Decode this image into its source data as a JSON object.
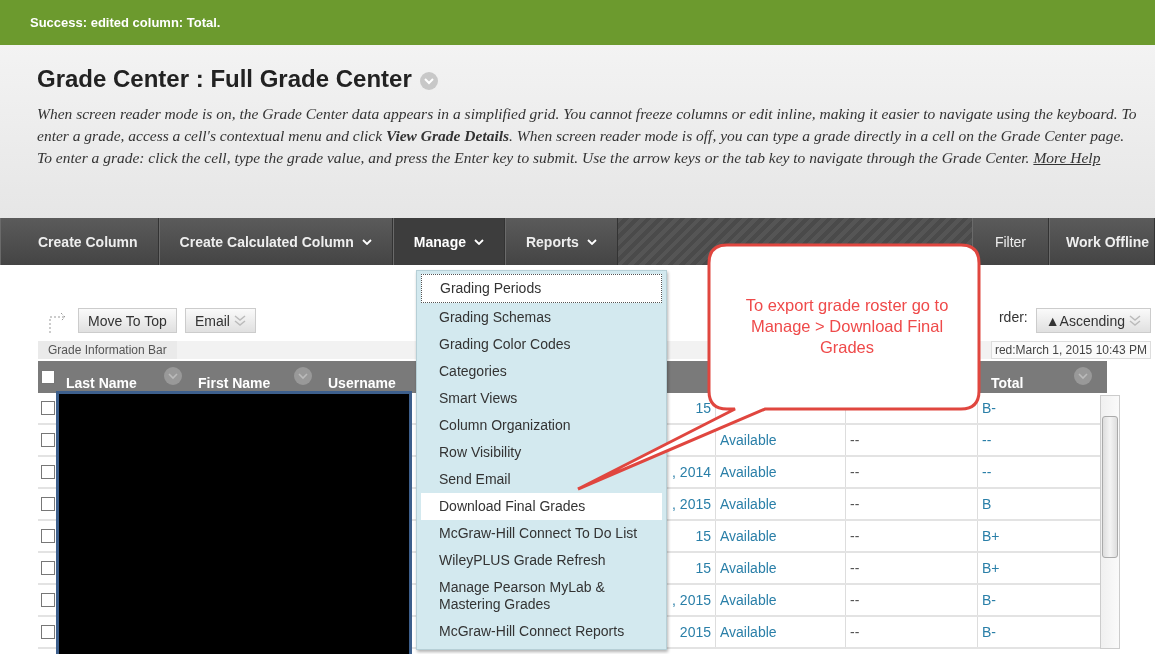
{
  "alert": {
    "text": "Success: edited column: Total."
  },
  "header": {
    "title": "Grade Center : Full Grade Center",
    "description": "When screen reader mode is on, the Grade Center data appears in a simplified grid. You cannot freeze columns or edit inline, making it easier to navigate using the keyboard. To enter a grade, access a cell's contextual menu and click **View Grade Details**. When screen reader mode is off, you can type a grade directly in a cell on the Grade Center page. To enter a grade: click the cell, type the grade value, and press the Enter key to submit. Use the arrow keys or the tab key to navigate through the Grade Center.",
    "help_link": "More Help"
  },
  "toolbar": [
    {
      "label": "Create Column",
      "has_menu": false,
      "selected": false
    },
    {
      "label": "Create Calculated Column",
      "has_menu": true,
      "selected": false
    },
    {
      "label": "Manage",
      "has_menu": true,
      "selected": true
    },
    {
      "label": "Reports",
      "has_menu": true,
      "selected": false
    }
  ],
  "toolbar_right": [
    {
      "label": "Filter",
      "bold": false
    },
    {
      "label": "Work Offline",
      "bold": true
    }
  ],
  "actions": [
    {
      "label": "Move To Top",
      "has_menu": false
    },
    {
      "label": "Email",
      "has_menu": true
    }
  ],
  "info_bar": {
    "label": "Grade Information Bar"
  },
  "sort": {
    "label": "rder:",
    "value": "▲Ascending"
  },
  "last_saved": "red:March 1, 2015 10:43 PM",
  "grid": {
    "select_all": false,
    "columns": [
      {
        "label": "Last Name",
        "menu": true
      },
      {
        "label": "First Name",
        "menu": true
      },
      {
        "label": "Username",
        "menu": false
      }
    ],
    "total_column": {
      "label": "Total",
      "menu": true
    },
    "rows": [
      {
        "checked": false,
        "date": "15",
        "total": "B-"
      },
      {
        "checked": false,
        "availability": "Available",
        "grade": "--",
        "total": "--"
      },
      {
        "checked": false,
        "date": ", 2014",
        "availability": "Available",
        "grade": "--",
        "total": "--"
      },
      {
        "checked": false,
        "date": ", 2015",
        "availability": "Available",
        "grade": "--",
        "total": "B"
      },
      {
        "checked": false,
        "date": "15",
        "availability": "Available",
        "grade": "--",
        "total": "B+"
      },
      {
        "checked": false,
        "date": "15",
        "availability": "Available",
        "grade": "--",
        "total": "B+"
      },
      {
        "checked": false,
        "date": ", 2015",
        "availability": "Available",
        "grade": "--",
        "total": "B-"
      },
      {
        "checked": false,
        "date": "2015",
        "availability": "Available",
        "grade": "--",
        "total": "B-"
      }
    ]
  },
  "manage_menu": {
    "items": [
      {
        "label": "Grading Periods",
        "focused": true,
        "highlighted": false
      },
      {
        "label": "Grading Schemas",
        "focused": false,
        "highlighted": false
      },
      {
        "label": "Grading Color Codes",
        "focused": false,
        "highlighted": false
      },
      {
        "label": "Categories",
        "focused": false,
        "highlighted": false
      },
      {
        "label": "Smart Views",
        "focused": false,
        "highlighted": false
      },
      {
        "label": "Column Organization",
        "focused": false,
        "highlighted": false
      },
      {
        "label": "Row Visibility",
        "focused": false,
        "highlighted": false
      },
      {
        "label": "Send Email",
        "focused": false,
        "highlighted": false
      },
      {
        "label": "Download Final Grades",
        "focused": false,
        "highlighted": true
      },
      {
        "label": "McGraw-Hill Connect To Do List",
        "focused": false,
        "highlighted": false
      },
      {
        "label": "WileyPLUS Grade Refresh",
        "focused": false,
        "highlighted": false
      },
      {
        "label": "Manage Pearson MyLab & Mastering Grades",
        "focused": false,
        "highlighted": false
      },
      {
        "label": "McGraw-Hill Connect Reports",
        "focused": false,
        "highlighted": false
      }
    ]
  },
  "callout": {
    "text": "To export grade roster go to Manage > Download Final Grades"
  }
}
